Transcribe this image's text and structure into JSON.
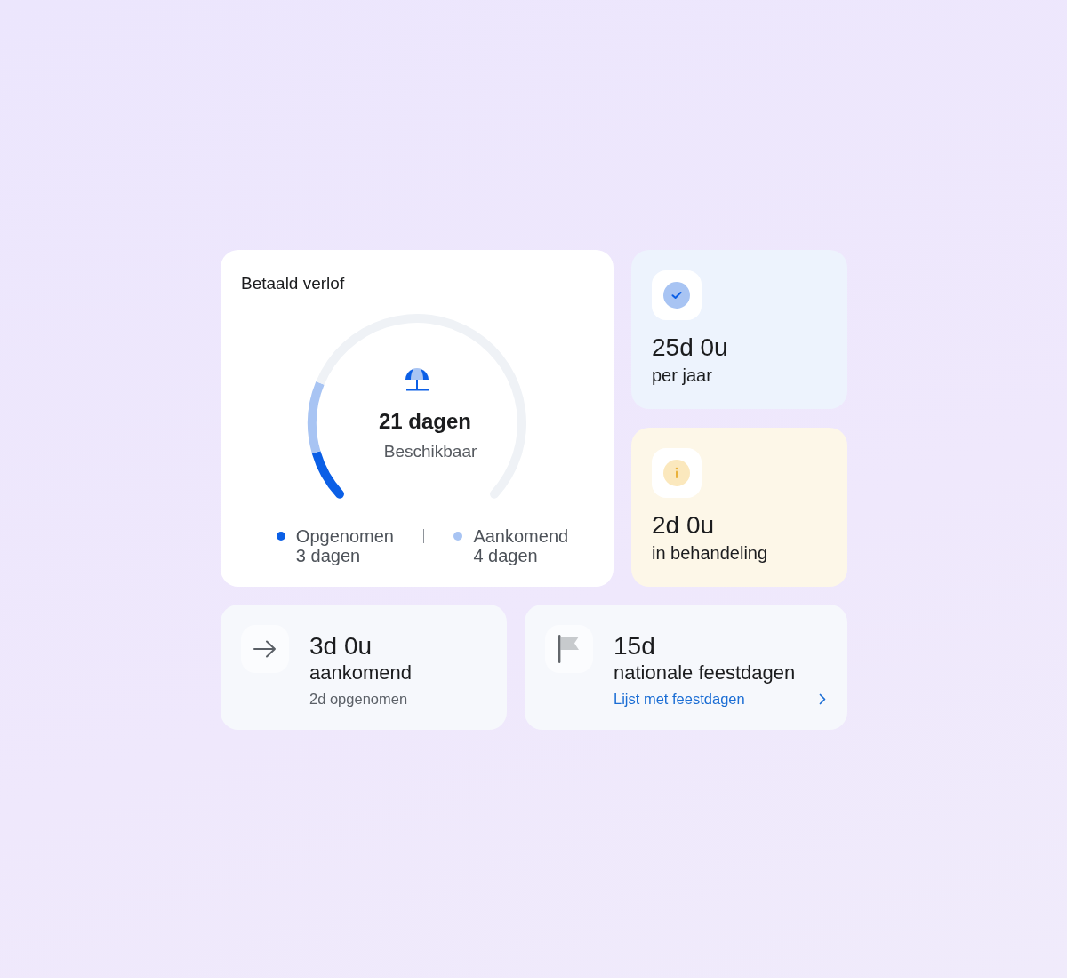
{
  "leave_card": {
    "title": "Betaald verlof",
    "gauge": {
      "value": "21 dagen",
      "caption": "Beschikbaar",
      "chart_data": {
        "type": "donut",
        "values": [
          10.7,
          14.3,
          75
        ]
      }
    },
    "legend": [
      {
        "label": "Opgenomen",
        "value": "3 dagen",
        "color": "#0b5fe6"
      },
      {
        "label": "Aankomend",
        "value": "4 dagen",
        "color": "#a8c4f3"
      }
    ]
  },
  "side_cards": [
    {
      "kind": "allowance",
      "value": "25d 0u",
      "caption": "per jaar"
    },
    {
      "kind": "pending",
      "value": "2d 0u",
      "caption": "in behandeling"
    }
  ],
  "bottom_cards": [
    {
      "kind": "upcoming",
      "value": "3d 0u",
      "caption": "aankomend",
      "note": "2d opgenomen"
    },
    {
      "kind": "holidays",
      "value": "15d",
      "caption": "nationale feestdagen",
      "link": "Lijst met feestdagen"
    }
  ]
}
